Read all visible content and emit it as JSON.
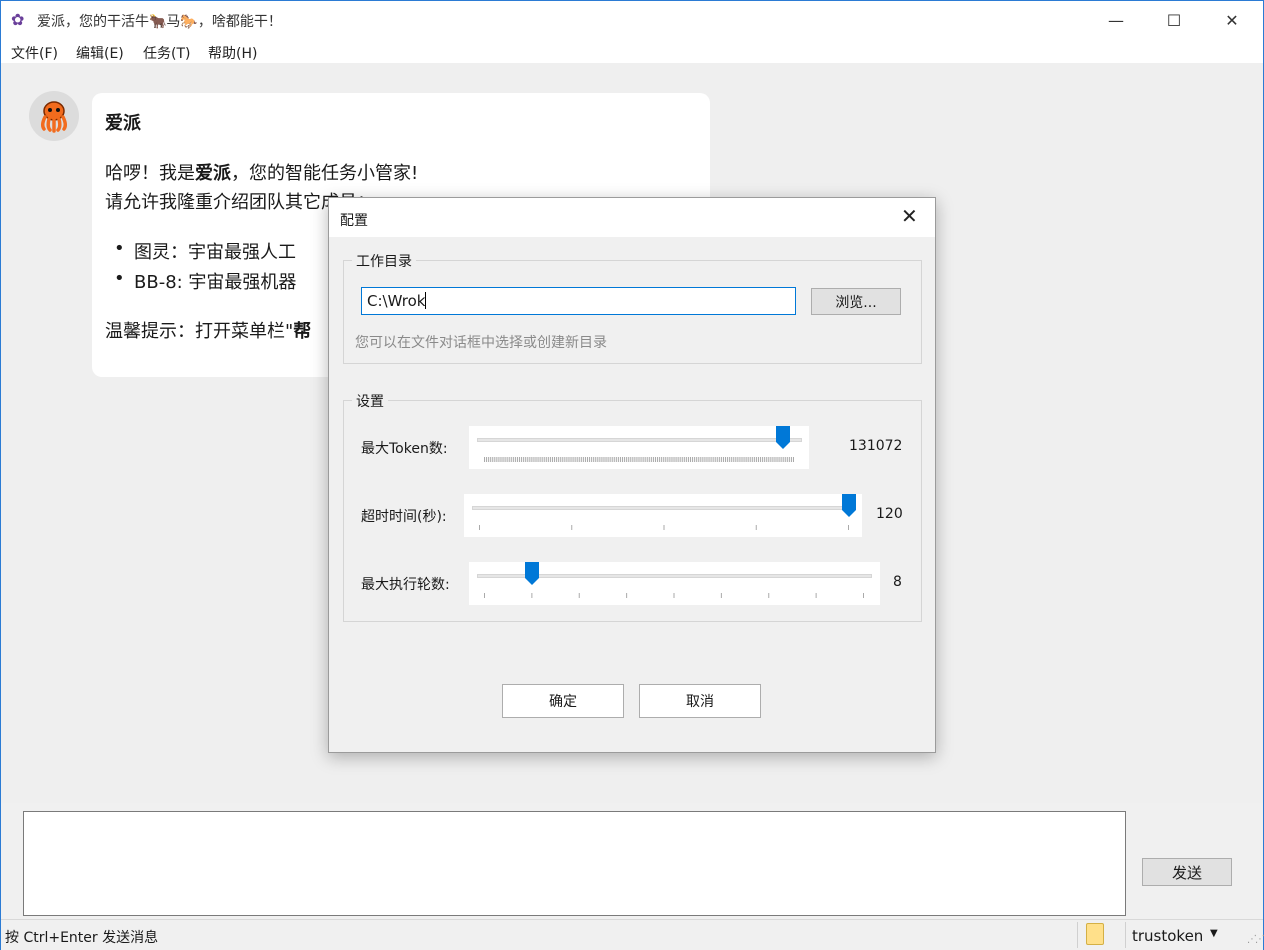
{
  "window": {
    "title": "爱派，您的干活牛🐂马🐎，啥都能干！",
    "icon": "octopus-icon"
  },
  "menu": [
    "文件(F)",
    "编辑(E)",
    "任务(T)",
    "帮助(H)"
  ],
  "chat": {
    "sender": "爱派",
    "avatar_icon": "octopus-icon",
    "line1_a": "哈啰！我是",
    "line1_bold": "爱派",
    "line1_b": "，您的智能任务小管家!",
    "line2": "请允许我隆重介绍团队其它成员：",
    "bullet1": "图灵：宇宙最强人工",
    "bullet2": "BB-8: 宇宙最强机器",
    "tip": "温馨提示：打开菜单栏\"",
    "tip_bold": "帮"
  },
  "input": {
    "value": ""
  },
  "send_label": "发送",
  "status": {
    "hint": "按 Ctrl+Enter 发送消息",
    "model": "trustoken",
    "folder_icon": "folder-icon"
  },
  "dialog": {
    "title": "配置",
    "workdir_group": "工作目录",
    "workdir_value": "C:\\Wrok",
    "browse_label": "浏览...",
    "workdir_hint": "您可以在文件对话框中选择或创建新目录",
    "settings_group": "设置",
    "sliders": [
      {
        "label": "最大Token数:",
        "value": "131072",
        "fraction": 0.96
      },
      {
        "label": "超时时间(秒):",
        "value": "120",
        "fraction": 1.0
      },
      {
        "label": "最大执行轮数:",
        "value": "8",
        "fraction": 0.125
      }
    ],
    "ok_label": "确定",
    "cancel_label": "取消"
  },
  "colors": {
    "accent": "#0078d7",
    "thumb": "#0078d7",
    "octopus": "#f26b1d"
  }
}
